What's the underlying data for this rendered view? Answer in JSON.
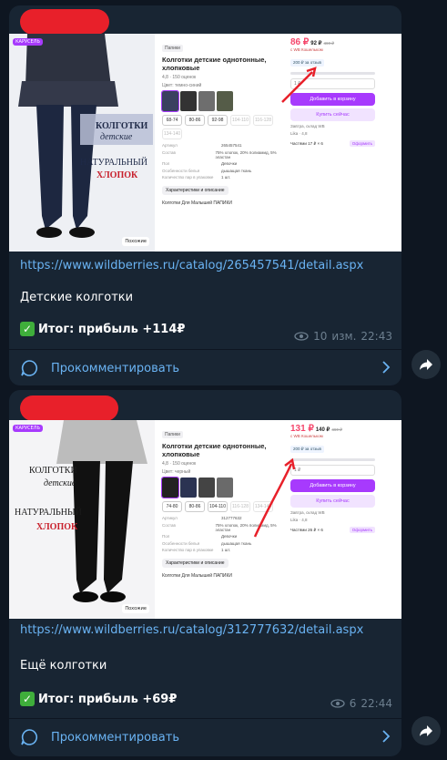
{
  "posts": [
    {
      "link": "https://www.wildberries.ru/catalog/265457541/detail.aspx",
      "description": "Детские колготки",
      "result": "Итог: прибыль +114₽",
      "views": "10",
      "edited": "изм.",
      "time": "22:43",
      "comment_label": "Прокомментировать",
      "product": {
        "badge": "КАРУСЕЛЬ",
        "photo_text": [
          "КОЛГОТКИ",
          "детские",
          "НАТУРАЛЬНЫЙ",
          "ХЛОПОК"
        ],
        "photo_button": "Похожие",
        "category": "Папики",
        "title": "Колготки детские однотонные, хлопковые",
        "rating": "4,8 · 150 оценок",
        "color": "Цвет: темно-синий",
        "sizes": [
          "68-74",
          "80-86",
          "92-98",
          "104-110",
          "116-128",
          "134-140"
        ],
        "specs": [
          [
            "Артикул",
            "265457541"
          ],
          [
            "Состав",
            "75% хлопок, 20% полиамид, 5% эластан"
          ],
          [
            "Пол",
            "Девочки"
          ],
          [
            "Особенности белья",
            "дышащая ткань"
          ],
          [
            "Количество пар в упаковке",
            "1 шт."
          ]
        ],
        "chars_button": "Характеристики и описание",
        "recommend": "Колготки Для Малышей ПАПИКИ",
        "price": "86 ₽",
        "price_wallet": "92 ₽",
        "price_old": "460 ₽",
        "wb_label": "с WB Кошельком",
        "coupon": "200 ₽ за отзыв",
        "qty": "1 ₽",
        "cart_button": "Добавить в корзину",
        "buy_button": "Купить сейчас",
        "delivery": "Завтра, склад WB",
        "seller": "Lika · 4,8",
        "installments": "Частями 17 ₽ × 6",
        "installments_button": "Оформить"
      }
    },
    {
      "link": "https://www.wildberries.ru/catalog/312777632/detail.aspx",
      "description": "Ещё колготки",
      "result": "Итог: прибыль +69₽",
      "views": "6",
      "edited": "",
      "time": "22:44",
      "comment_label": "Прокомментировать",
      "product": {
        "badge": "КАРУСЕЛЬ",
        "photo_text": [
          "КОЛГОТКИ",
          "детские",
          "НАТУРАЛЬНЫЙ",
          "ХЛОПОК"
        ],
        "photo_button": "Похожие",
        "category": "Папики",
        "title": "Колготки детские однотонные, хлопковые",
        "rating": "4,8 · 150 оценок",
        "color": "Цвет: черный",
        "sizes": [
          "74-80",
          "80-86",
          "104-110",
          "116-128",
          "134-140"
        ],
        "specs": [
          [
            "Артикул",
            "312777632"
          ],
          [
            "Состав",
            "75% хлопок, 20% полиамид, 5% эластан"
          ],
          [
            "Пол",
            "Девочки"
          ],
          [
            "Особенности белья",
            "дышащая ткань"
          ],
          [
            "Количество пар в упаковке",
            "1 шт."
          ]
        ],
        "chars_button": "Характеристики и описание",
        "recommend": "Колготки Для Малышей ПАПИКИ",
        "price": "131 ₽",
        "price_wallet": "140 ₽",
        "price_old": "460 ₽",
        "wb_label": "с WB Кошельком",
        "coupon": "200 ₽ за отзыв",
        "qty": "1 ₽",
        "cart_button": "Добавить в корзину",
        "buy_button": "Купить сейчас",
        "delivery": "Завтра, склад WB",
        "seller": "Lika · 4,8",
        "installments": "Частями 26 ₽ × 6",
        "installments_button": "Оформить"
      }
    }
  ],
  "colors": {
    "background": "#0e1621",
    "bubble": "#182533",
    "link": "#6ab3f3",
    "redaction": "#e8202a",
    "accent": "#a73afd",
    "price": "#f5466b",
    "check": "#3fae3b"
  }
}
